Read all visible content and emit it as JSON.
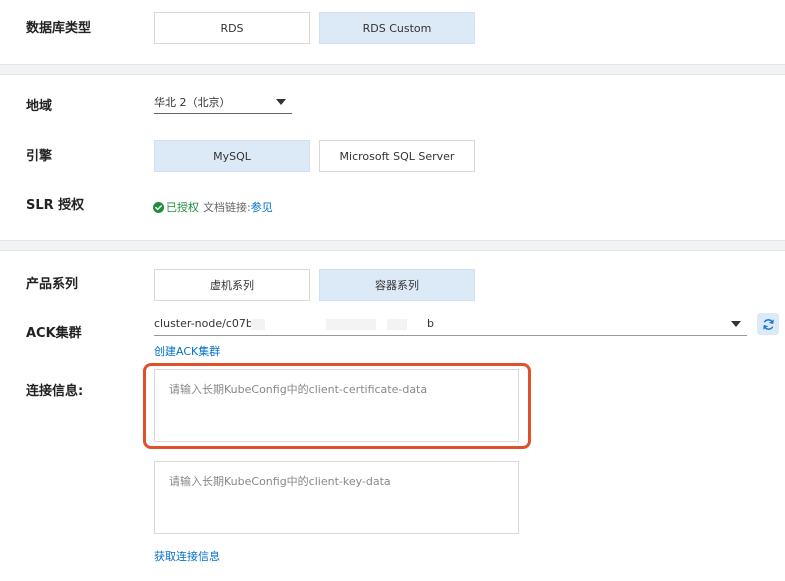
{
  "db_type": {
    "label": "数据库类型",
    "options": [
      "RDS",
      "RDS Custom"
    ]
  },
  "region": {
    "label": "地域",
    "value": "华北 2（北京）"
  },
  "engine": {
    "label": "引擎",
    "options": [
      "MySQL",
      "Microsoft SQL Server"
    ]
  },
  "slr": {
    "label": "SLR 授权",
    "status": "已授权",
    "doc_prefix": "文档链接:",
    "doc_link": "参见",
    "status_color": "#1e8e3e"
  },
  "product_series": {
    "label": "产品系列",
    "options": [
      "虚机系列",
      "容器系列"
    ]
  },
  "ack_cluster": {
    "label": "ACK集群",
    "value_prefix": "cluster-node/c07b",
    "value_suffix": "b",
    "create_link": "创建ACK集群"
  },
  "connection": {
    "label": "连接信息:",
    "cert_placeholder": "请输入长期KubeConfig中的client-certificate-data",
    "key_placeholder": "请输入长期KubeConfig中的client-key-data",
    "get_link": "获取连接信息"
  },
  "colors": {
    "accent": "#0070cc",
    "selected_bg": "#dce9f7",
    "highlight": "#e0502b"
  }
}
